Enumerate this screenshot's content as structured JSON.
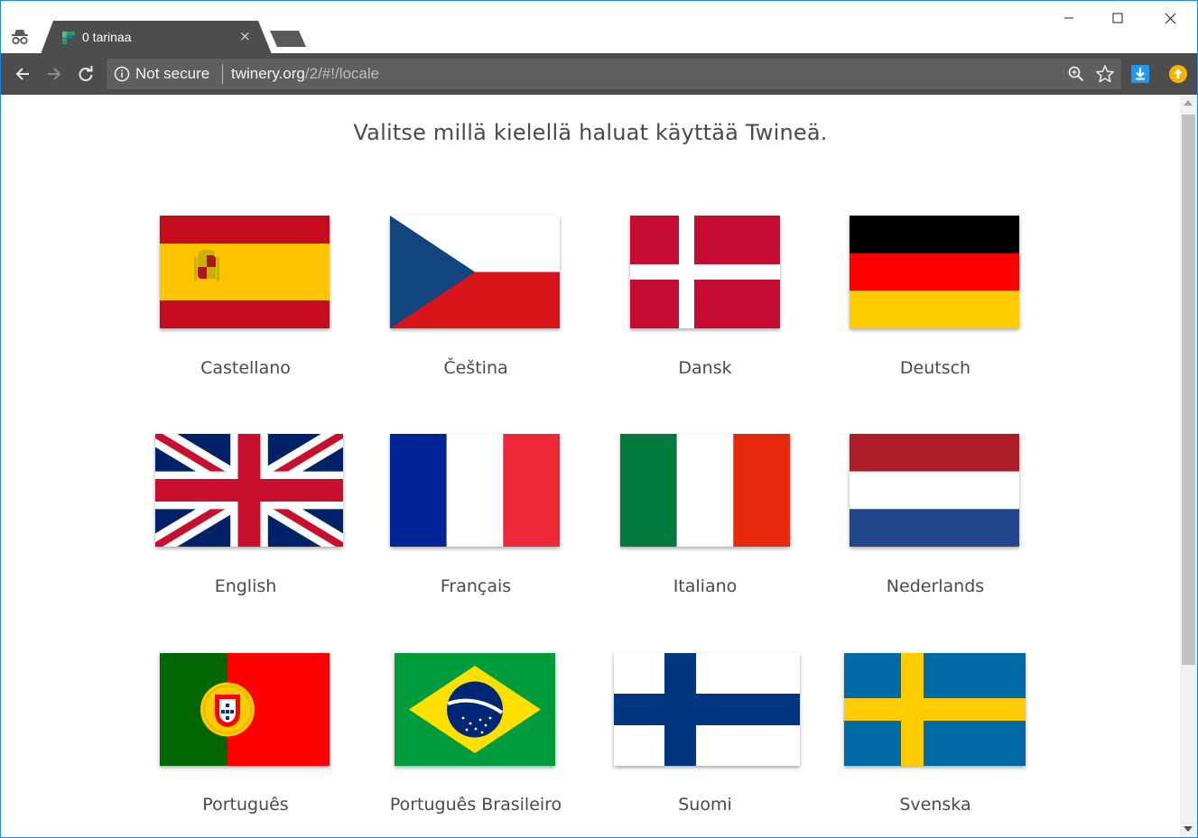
{
  "browser": {
    "tab_title": "0 tarinaa",
    "tab_close_glyph": "×",
    "security_label": "Not secure",
    "url_host": "twinery.org",
    "url_path": "/2/#!/locale",
    "accent_color": "#4d4d4d"
  },
  "page": {
    "heading": "Valitse millä kielellä haluat käyttää Twineä.",
    "languages": [
      {
        "label": "Castellano",
        "flag": "spain-flag-icon"
      },
      {
        "label": "Čeština",
        "flag": "czech-flag-icon"
      },
      {
        "label": "Dansk",
        "flag": "denmark-flag-icon"
      },
      {
        "label": "Deutsch",
        "flag": "germany-flag-icon"
      },
      {
        "label": "English",
        "flag": "uk-flag-icon"
      },
      {
        "label": "Français",
        "flag": "france-flag-icon"
      },
      {
        "label": "Italiano",
        "flag": "italy-flag-icon"
      },
      {
        "label": "Nederlands",
        "flag": "netherlands-flag-icon"
      },
      {
        "label": "Português",
        "flag": "portugal-flag-icon"
      },
      {
        "label": "Português Brasileiro",
        "flag": "brazil-flag-icon"
      },
      {
        "label": "Suomi",
        "flag": "finland-flag-icon"
      },
      {
        "label": "Svenska",
        "flag": "sweden-flag-icon"
      }
    ]
  }
}
